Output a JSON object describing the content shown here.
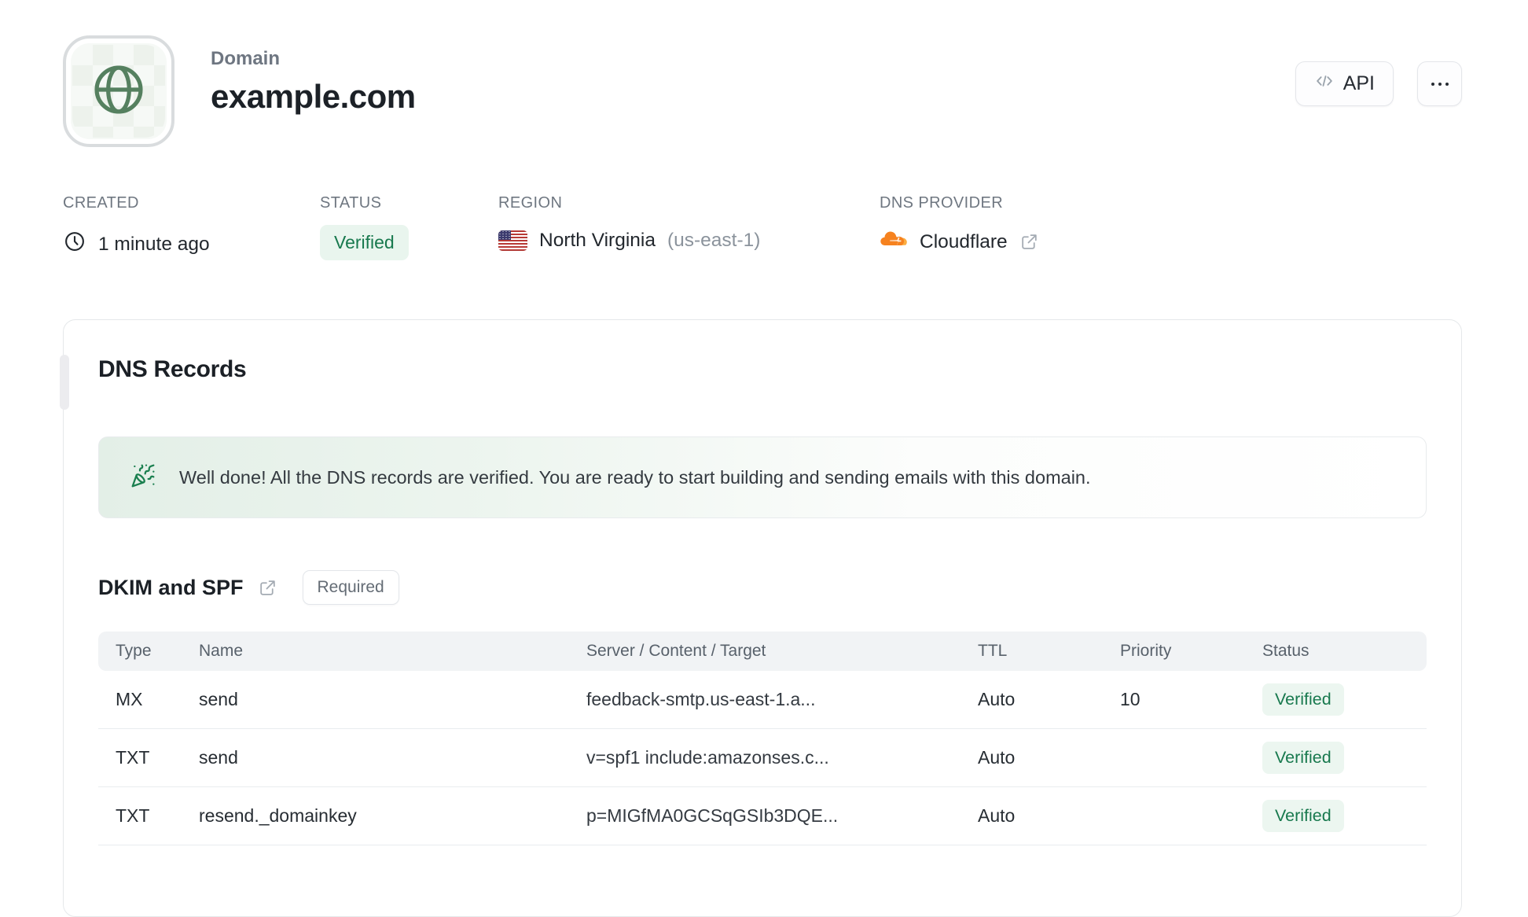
{
  "header": {
    "eyebrow": "Domain",
    "title": "example.com",
    "api_button_label": "API",
    "icons": {
      "avatar": "globe-icon",
      "api": "code-icon",
      "more": "ellipsis-icon"
    }
  },
  "meta": {
    "created": {
      "label": "CREATED",
      "value": "1 minute ago",
      "icon": "clock-icon"
    },
    "status": {
      "label": "STATUS",
      "value": "Verified"
    },
    "region": {
      "label": "REGION",
      "value": "North Virginia",
      "code": "(us-east-1)",
      "icon": "us-flag-icon"
    },
    "dns_provider": {
      "label": "DNS PROVIDER",
      "value": "Cloudflare",
      "icon": "cloudflare-icon"
    }
  },
  "dns_card": {
    "title": "DNS Records",
    "banner_message": "Well done! All the DNS records are verified. You are ready to start building and sending emails with this domain.",
    "section": {
      "title": "DKIM and SPF",
      "badge": "Required"
    },
    "table": {
      "headers": [
        "Type",
        "Name",
        "Server / Content / Target",
        "TTL",
        "Priority",
        "Status"
      ],
      "rows": [
        {
          "type": "MX",
          "name": "send",
          "content": "feedback-smtp.us-east-1.a...",
          "ttl": "Auto",
          "priority": "10",
          "status": "Verified"
        },
        {
          "type": "TXT",
          "name": "send",
          "content": "v=spf1 include:amazonses.c...",
          "ttl": "Auto",
          "priority": "",
          "status": "Verified"
        },
        {
          "type": "TXT",
          "name": "resend._domainkey",
          "content": "p=MIGfMA0GCSqGSIb3DQE...",
          "ttl": "Auto",
          "priority": "",
          "status": "Verified"
        }
      ]
    }
  },
  "colors": {
    "accent_green": "#18794e",
    "badge_bg": "#e9f5ee",
    "globe_green": "#55805f",
    "cloudflare_orange": "#f6821f",
    "banner_green": "#e3efe7",
    "border": "#e5e8ea",
    "text_dark": "#1c2127",
    "text_gray": "#6f7781"
  }
}
